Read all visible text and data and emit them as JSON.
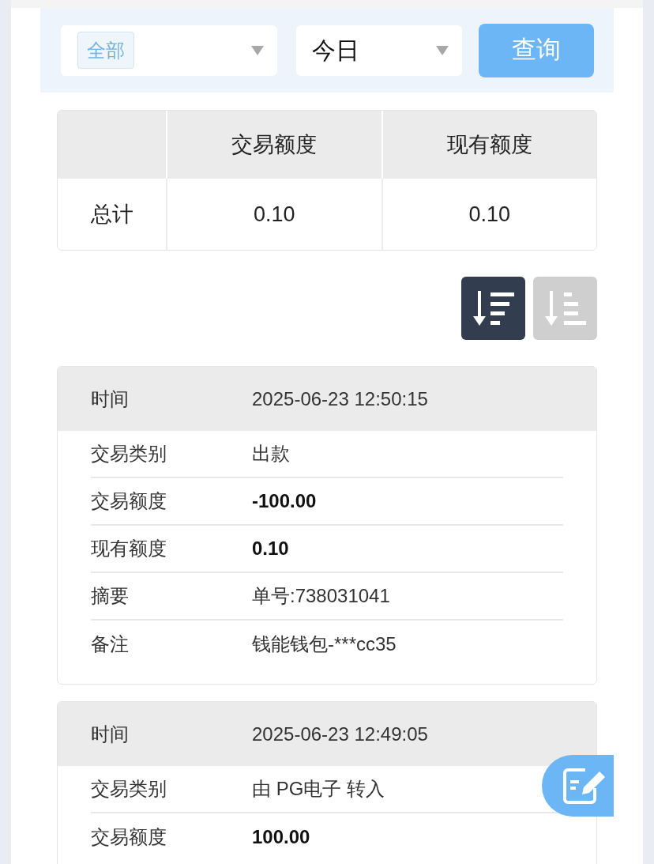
{
  "filter_bar": {
    "type_select": {
      "tag": "全部"
    },
    "period_select": {
      "value": "今日"
    },
    "query_button": "查询"
  },
  "summary_table": {
    "columns": [
      "交易额度",
      "现有额度"
    ],
    "rows": [
      {
        "label": "总计",
        "values": [
          "0.10",
          "0.10"
        ]
      }
    ]
  },
  "sort_buttons": [
    {
      "kind": "descending",
      "selected": true
    },
    {
      "kind": "ascending",
      "selected": false
    }
  ],
  "records": [
    {
      "time_label": "时间",
      "time": "2025-06-23 12:50:15",
      "fields": [
        {
          "label": "交易类别",
          "value": "出款",
          "bold": false
        },
        {
          "label": "交易额度",
          "value": "-100.00",
          "bold": true
        },
        {
          "label": "现有额度",
          "value": "0.10",
          "bold": true
        },
        {
          "label": "摘要",
          "value": "单号:738031041",
          "bold": false
        },
        {
          "label": "备注",
          "value": "钱能钱包-***cc35",
          "bold": false
        }
      ]
    },
    {
      "time_label": "时间",
      "time": "2025-06-23 12:49:05",
      "fields": [
        {
          "label": "交易类别",
          "value": "由 PG电子 转入",
          "bold": false
        },
        {
          "label": "交易额度",
          "value": "100.00",
          "bold": true
        }
      ]
    }
  ]
}
